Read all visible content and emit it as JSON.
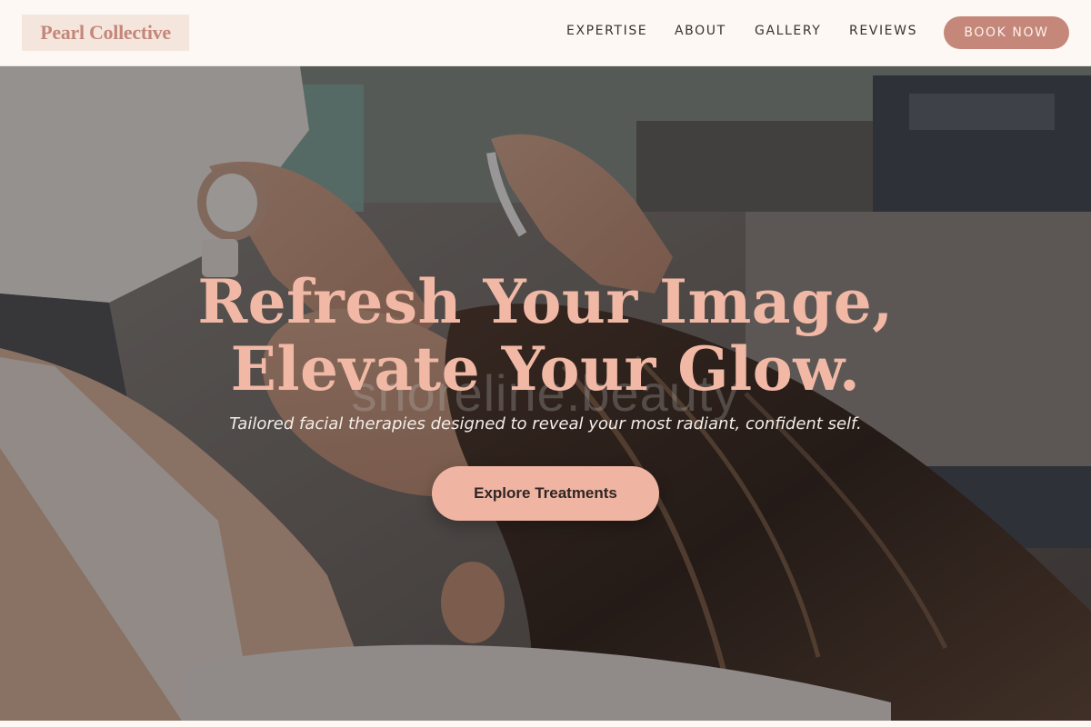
{
  "header": {
    "logo_text": "Pearl Collective",
    "nav": [
      {
        "label": "EXPERTISE"
      },
      {
        "label": "ABOUT"
      },
      {
        "label": "GALLERY"
      },
      {
        "label": "REVIEWS"
      }
    ],
    "book_label": "BOOK NOW"
  },
  "hero": {
    "headline_line1": "Refresh Your Image,",
    "headline_line2": "Elevate Your Glow.",
    "subheading": "Tailored facial therapies designed to reveal your most radiant, confident self.",
    "cta_label": "Explore Treatments",
    "watermark": "shoreline.beauty"
  },
  "colors": {
    "brand": "#c4877a",
    "accent": "#f0b5a2",
    "background": "#fdf8f4",
    "headline": "#f1b9a5"
  }
}
